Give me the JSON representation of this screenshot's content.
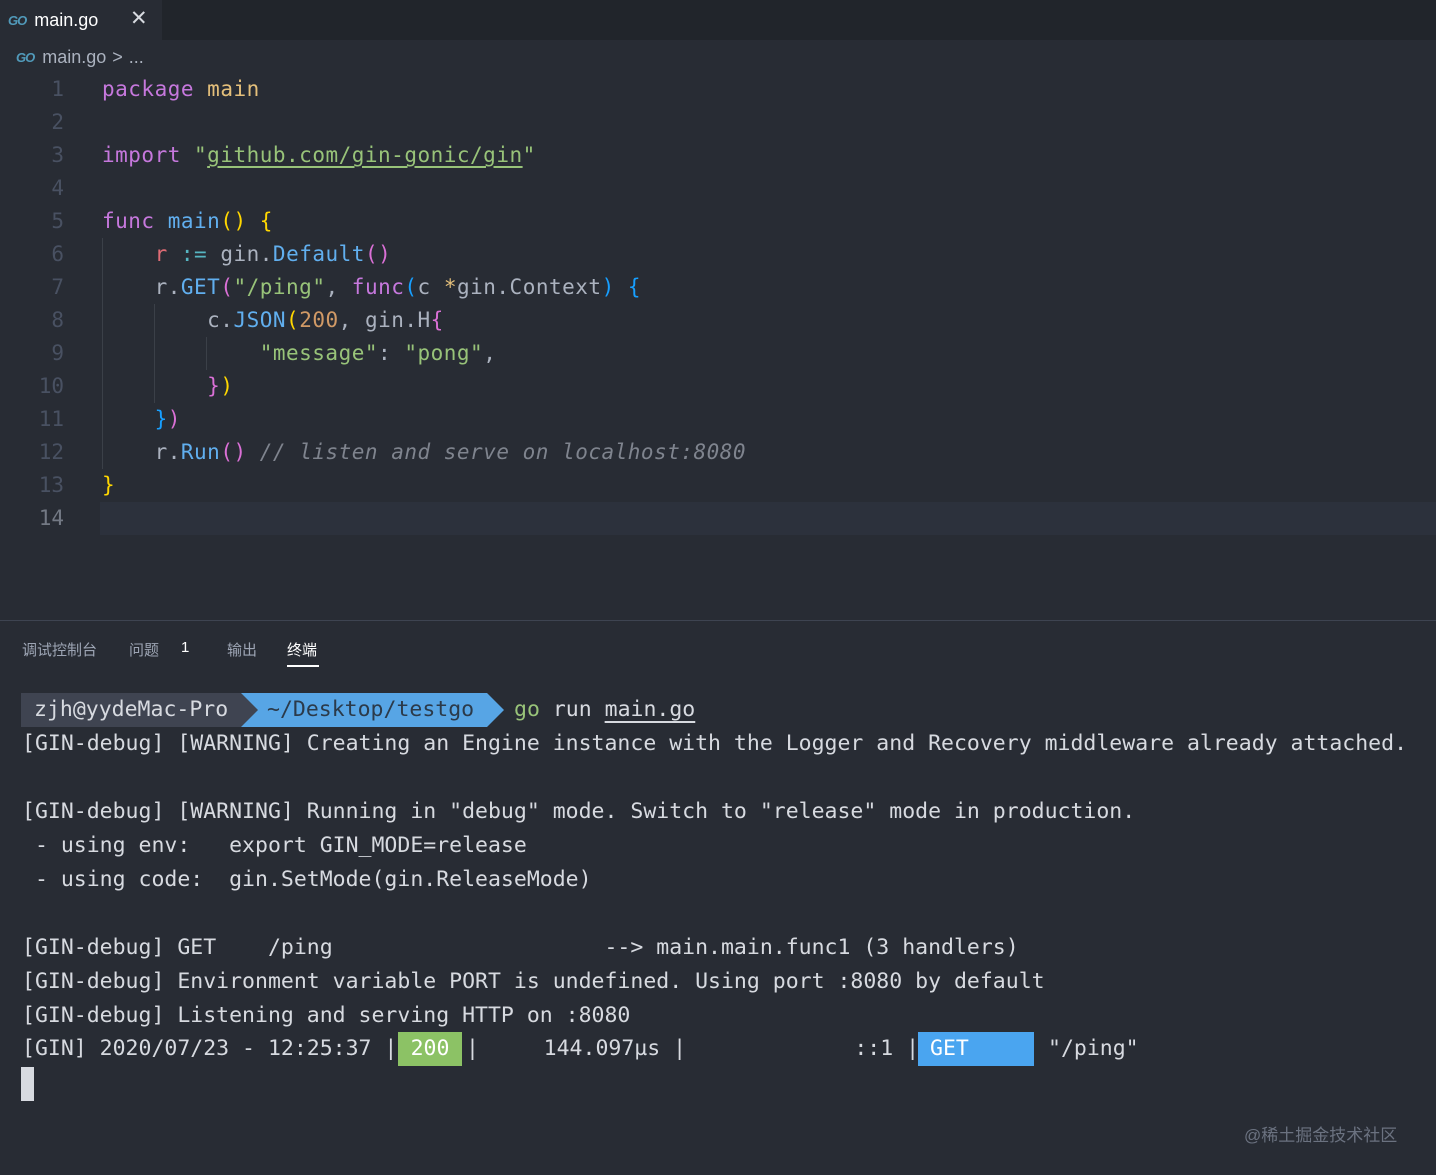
{
  "tab": {
    "icon": "go-icon",
    "label": "main.go"
  },
  "breadcrumb": {
    "file": "main.go",
    "separator": ">",
    "more": "..."
  },
  "editor": {
    "line_numbers": [
      "1",
      "2",
      "3",
      "4",
      "5",
      "6",
      "7",
      "8",
      "9",
      "10",
      "11",
      "12",
      "13",
      "14"
    ],
    "code": {
      "l1_kw": "package",
      "l1_name": "main",
      "l3_kw": "import",
      "l3_q1": "\"",
      "l3_path": "github.com/gin-gonic/gin",
      "l3_q2": "\"",
      "l5_kw": "func",
      "l5_fn": "main",
      "l5_paren": "()",
      "l5_brace": "{",
      "l6_var": "r",
      "l6_op": ":=",
      "l6_pkg": "gin.",
      "l6_fn": "Default",
      "l6_paren": "()",
      "l7_recv": "r.",
      "l7_fn": "GET",
      "l7_p1": "(",
      "l7_str": "\"/ping\"",
      "l7_comma": ",",
      "l7_kw": "func",
      "l7_p2": "(",
      "l7_param": "c ",
      "l7_star": "*",
      "l7_type": "gin.Context",
      "l7_p3": ")",
      "l7_brace": "{",
      "l8_recv": "c.",
      "l8_fn": "JSON",
      "l8_p": "(",
      "l8_num": "200",
      "l8_comma": ",",
      "l8_type": "gin.H",
      "l8_brace": "{",
      "l9_key": "\"message\"",
      "l9_colon": ":",
      "l9_val": "\"pong\"",
      "l9_comma": ",",
      "l10_brace": "}",
      "l10_paren": ")",
      "l11_brace": "}",
      "l11_paren": ")",
      "l12_recv": "r.",
      "l12_fn": "Run",
      "l12_paren": "()",
      "l12_comment": "// listen and serve on localhost:8080",
      "l13_brace": "}"
    }
  },
  "panel": {
    "tabs": [
      "调试控制台",
      "问题",
      "输出",
      "终端"
    ],
    "problems_count": "1",
    "active_tab": "终端"
  },
  "terminal": {
    "prompt_user": "zjh@yydeMac-Pro",
    "prompt_dir": "~/Desktop/testgo",
    "cmd_go": "go",
    "cmd_run": "run",
    "cmd_file": "main.go",
    "lines": [
      "[GIN-debug] [WARNING] Creating an Engine instance with the Logger and Recovery middleware already attached.",
      "[GIN-debug] [WARNING] Running in \"debug\" mode. Switch to \"release\" mode in production.",
      " - using env:   export GIN_MODE=release",
      " - using code:  gin.SetMode(gin.ReleaseMode)",
      "[GIN-debug] GET    /ping                     --> main.main.func1 (3 handlers)",
      "[GIN-debug] Environment variable PORT is undefined. Using port :8080 by default",
      "[GIN-debug] Listening and serving HTTP on :8080"
    ],
    "log": {
      "prefix": "[GIN] 2020/07/23 - 12:25:37 |",
      "status": "200",
      "middle": "|     144.097µs |             ::1 |",
      "method": "GET",
      "path": "\"/ping\""
    }
  },
  "watermark": "@稀土掘金技术社区"
}
